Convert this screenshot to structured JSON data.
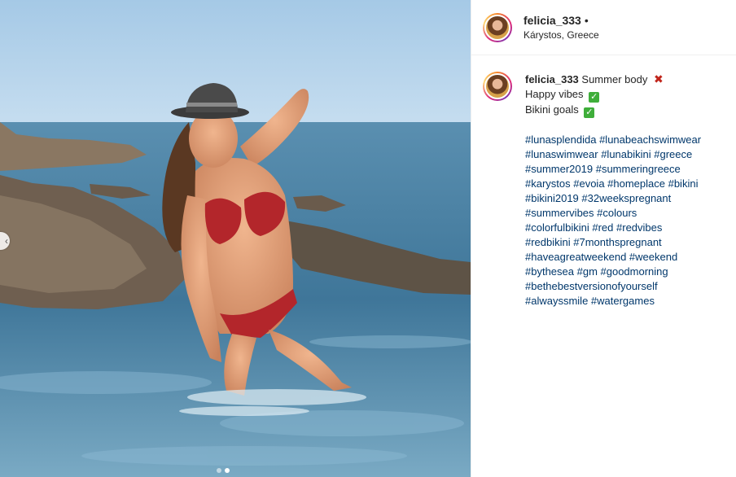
{
  "post": {
    "username": "felicia_333",
    "separator": "•",
    "location": "Kárystos, Greece"
  },
  "photo": {
    "carousel_total": 2,
    "carousel_active": 2
  },
  "caption": {
    "username": "felicia_333",
    "line1": "Summer body",
    "line1_emoji": "cross-mark-icon",
    "line2": "Happy vibes",
    "line2_emoji": "check-mark-icon",
    "line3": "Bikini goals",
    "line3_emoji": "check-mark-icon",
    "hashtag_lines": [
      "#lunasplendida #lunabeachswimwear",
      "#lunaswimwear #lunabikini #greece",
      "#summer2019 #summeringreece",
      "#karystos #evoia #homeplace #bikini",
      "#bikini2019 #32weekspregnant",
      "#summervibes #colours",
      "#colorfulbikini #red #redvibes",
      "#redbikini #7monthspregnant",
      "#haveagreatweekend #weekend",
      "#bythesea #gm #goodmorning",
      "#bethebestversionofyourself",
      "#alwayssmile #watergames"
    ]
  },
  "colors": {
    "link": "#00376b",
    "check": "#3fae3a",
    "cross": "#c0251b"
  }
}
